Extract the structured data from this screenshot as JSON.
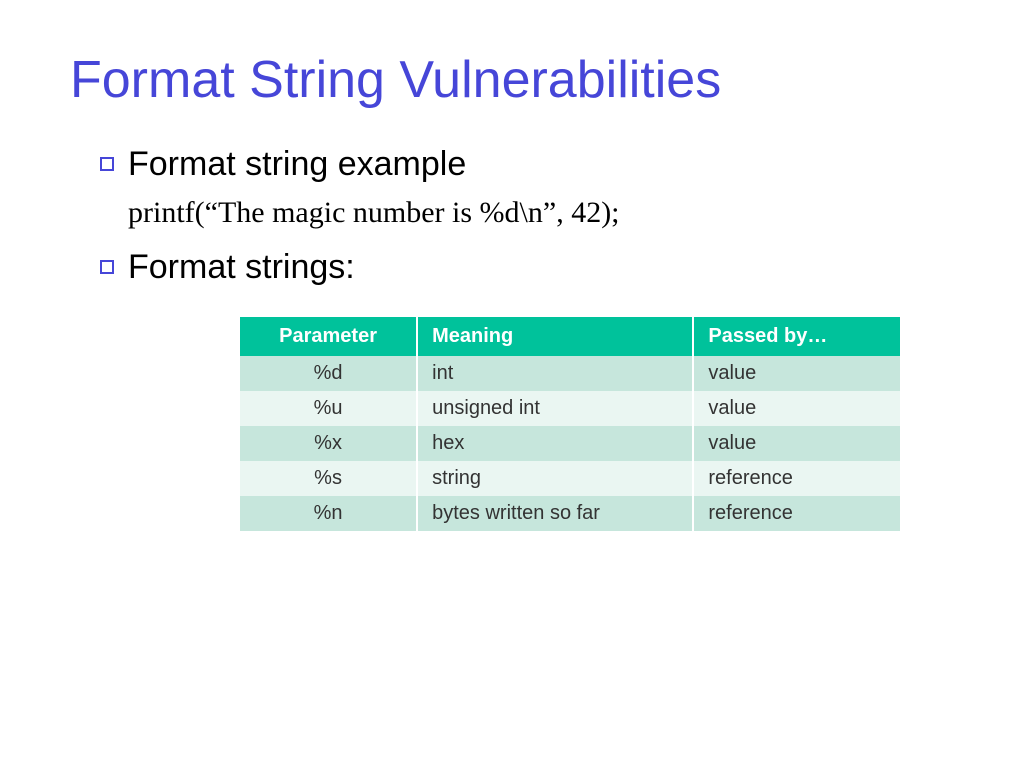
{
  "title": "Format String Vulnerabilities",
  "bullets": {
    "b1": "Format string example",
    "b2": "Format strings:"
  },
  "code": "printf(“The magic number is %d\\n”, 42);",
  "table": {
    "headers": {
      "c1": "Parameter",
      "c2": "Meaning",
      "c3": "Passed by…"
    },
    "rows": [
      {
        "c1": "%d",
        "c2": "int",
        "c3": "value"
      },
      {
        "c1": "%u",
        "c2": "unsigned int",
        "c3": "value"
      },
      {
        "c1": "%x",
        "c2": "hex",
        "c3": "value"
      },
      {
        "c1": "%s",
        "c2": "string",
        "c3": "reference"
      },
      {
        "c1": "%n",
        "c2": "bytes written so far",
        "c3": "reference"
      }
    ]
  }
}
